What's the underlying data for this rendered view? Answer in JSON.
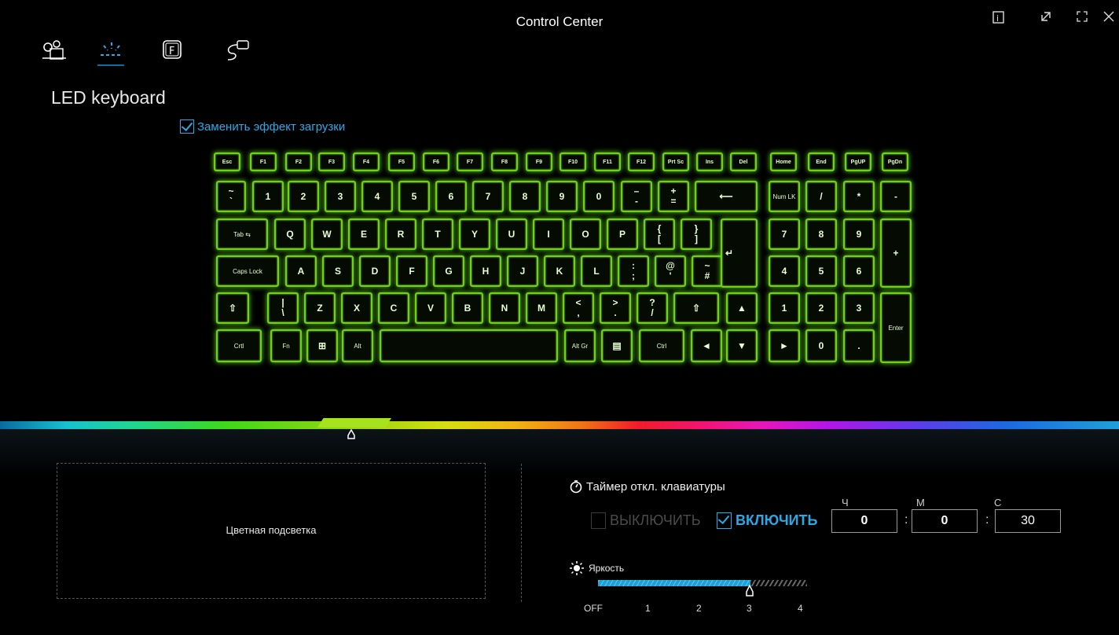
{
  "window": {
    "title": "Control Center"
  },
  "header_icons": [
    "settings-icon",
    "led-icon",
    "function-key-icon",
    "usb-icon"
  ],
  "page": {
    "heading": "LED keyboard",
    "boot_effect_label": "Заменить эффект загрузки",
    "boot_effect_checked": true
  },
  "keys": {
    "row0": [
      "Esc",
      "F1",
      "F2",
      "F3",
      "F4",
      "F5",
      "F6",
      "F7",
      "F8",
      "F9",
      "F10",
      "F11",
      "F12",
      "Prt Sc",
      "Ins",
      "Del",
      "Home",
      "End",
      "PgUP",
      "PgDn"
    ],
    "row1": [
      "~\n`",
      "1",
      "2",
      "3",
      "4",
      "5",
      "6",
      "7",
      "8",
      "9",
      "0",
      "–\n-",
      "+\n=",
      "⟵",
      "Num LK",
      "/",
      "*",
      "-"
    ],
    "row2": [
      "Tab ⇆",
      "Q",
      "W",
      "E",
      "R",
      "T",
      "Y",
      "U",
      "I",
      "O",
      "P",
      "{\n[",
      "}\n]",
      "7",
      "8",
      "9",
      "+"
    ],
    "row3": [
      "Caps Lock",
      "A",
      "S",
      "D",
      "F",
      "G",
      "H",
      "J",
      "K",
      "L",
      ":\n;",
      "@\n'",
      "~\n#",
      "↵",
      "4",
      "5",
      "6"
    ],
    "row4": [
      "⇧",
      "|\n\\",
      "Z",
      "X",
      "C",
      "V",
      "B",
      "N",
      "M",
      "<\n,",
      ">\n.",
      "?\n/",
      "⇧",
      "▲",
      "1",
      "2",
      "3",
      "Enter"
    ],
    "row5": [
      "Crtl",
      "Fn",
      "⊞",
      "Alt",
      "",
      "Alt Gr",
      "▤",
      "Ctrl",
      "◄",
      "▼",
      "►",
      "0",
      "."
    ]
  },
  "lighting": {
    "mode_label": "Цветная подсветка"
  },
  "timer": {
    "title": "Таймер откл. клавиатуры",
    "off_label": "ВЫКЛЮЧИТЬ",
    "on_label": "ВКЛЮЧИТЬ",
    "selected": "on",
    "hours_label": "Ч",
    "minutes_label": "М",
    "seconds_label": "С",
    "hours": "0",
    "minutes": "0",
    "seconds": "30"
  },
  "brightness": {
    "title": "Яркость",
    "level": 3,
    "ticks": [
      "OFF",
      "1",
      "2",
      "3",
      "4"
    ]
  },
  "colors": {
    "accent": "#2aa9e6",
    "key_glow": "#6cd316"
  }
}
